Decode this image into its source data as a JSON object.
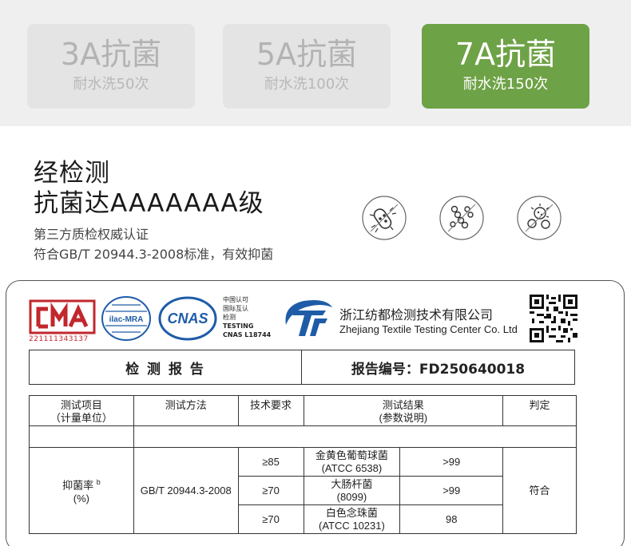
{
  "grades": [
    {
      "title": "3A抗菌",
      "sub": "耐水洗50次",
      "active": false
    },
    {
      "title": "5A抗菌",
      "sub": "耐水洗100次",
      "active": false
    },
    {
      "title": "7A抗菌",
      "sub": "耐水洗150次",
      "active": true
    }
  ],
  "headline": {
    "line1": "经检测",
    "line2": "抗菌达AAAAAAA级"
  },
  "subline": {
    "line1": "第三方质检权威认证",
    "line2": "符合GB/T 20944.3-2008标准，有效抑菌"
  },
  "icons": [
    "bacteria-rod-icon",
    "bacteria-chain-icon",
    "bacteria-cluster-icon"
  ],
  "logos": {
    "cma_letters": "CMA",
    "cma_number": "221111343137",
    "ilac_text": "ilac-MRA",
    "cnas_text": "CNAS",
    "cnas_small": [
      "中国认可",
      "国际互认",
      "检测",
      "TESTING",
      "CNAS L18744"
    ],
    "center_name_cn": "浙江纺都检测技术有限公司",
    "center_name_en": "Zhejiang Textile Testing Center Co. Ltd"
  },
  "report": {
    "title": "检 测 报 告",
    "number": "报告编号：FD250640018"
  },
  "table": {
    "headers": {
      "item": "测试项目",
      "item_unit": "（计量单位）",
      "method": "测试方法",
      "requirement": "技术要求",
      "result": "测试结果",
      "result_note": "(参数说明)",
      "verdict": "判定"
    },
    "item_name": "抑菌率",
    "item_sup": "b",
    "item_unit": "(%)",
    "method": "GB/T 20944.3-2008",
    "verdict": "符合",
    "rows": [
      {
        "requirement": "≥85",
        "strain": "金黄色葡萄球菌",
        "strain_code": "(ATCC 6538)",
        "value": ">99"
      },
      {
        "requirement": "≥70",
        "strain": "大肠杆菌",
        "strain_code": "(8099)",
        "value": ">99"
      },
      {
        "requirement": "≥70",
        "strain": "白色念珠菌",
        "strain_code": "(ATCC 10231)",
        "value": "98"
      }
    ]
  },
  "colors": {
    "accent_green": "#6ea246",
    "cma_red": "#c1272d",
    "brand_blue": "#1f5ca8"
  }
}
